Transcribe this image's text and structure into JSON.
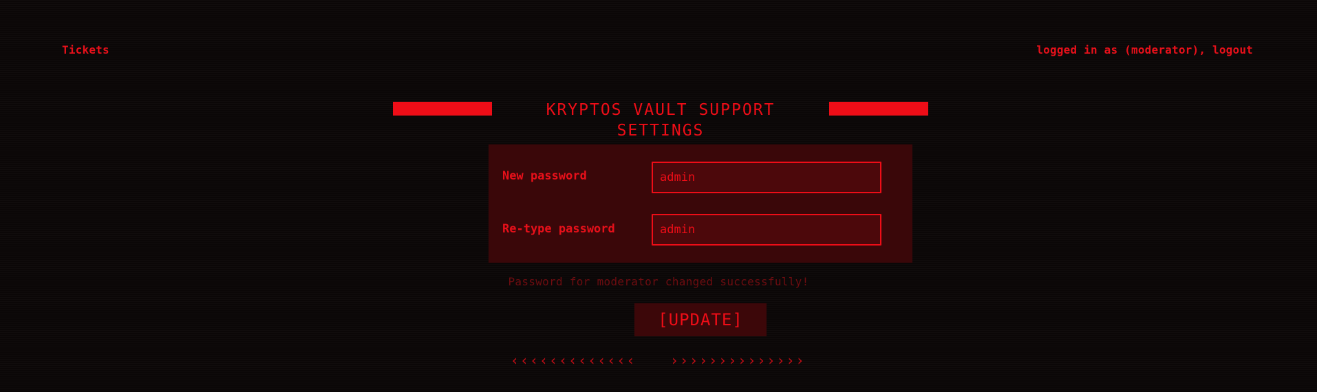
{
  "nav": {
    "tickets_label": "Tickets",
    "user_status": "logged in as (moderator), logout"
  },
  "page": {
    "title": "KRYPTOS VAULT SUPPORT SETTINGS"
  },
  "form": {
    "new_password_label": "New password",
    "new_password_value": "admin",
    "retype_password_label": "Re-type password",
    "retype_password_value": "admin",
    "status_message": "Password for moderator changed successfully!",
    "update_label": "[UPDATE]"
  },
  "pager": {
    "prev": "‹‹‹‹‹‹‹‹‹‹‹‹‹",
    "next": "››››››››››››››"
  },
  "colors": {
    "accent": "#ee0d17",
    "panel": "#3a0709",
    "background": "#0b0707",
    "status_text": "#6e0c10"
  },
  "icons": {
    "prev": "chevron-left-icon",
    "next": "chevron-right-icon"
  }
}
